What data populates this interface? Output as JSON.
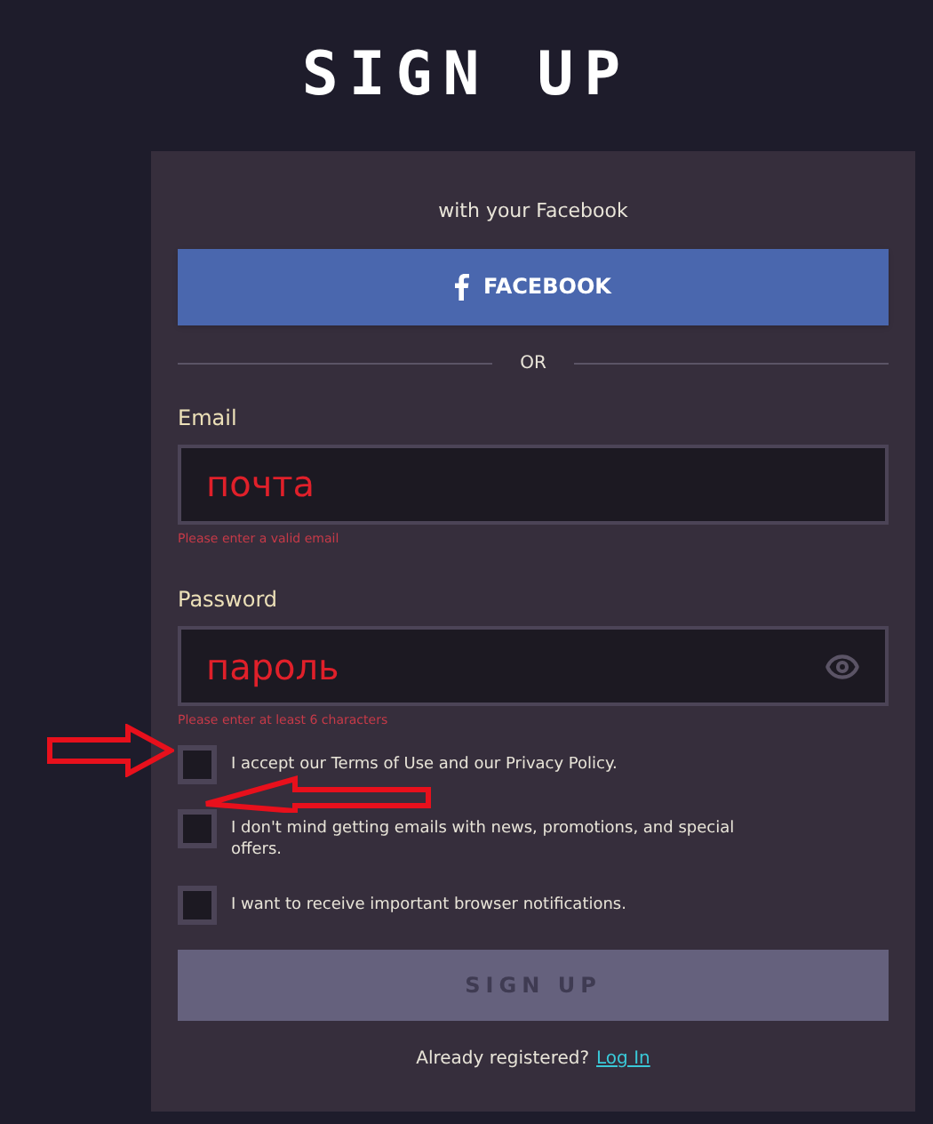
{
  "title": "SIGN UP",
  "facebook": {
    "caption": "with your Facebook",
    "button": "FACEBOOK"
  },
  "separator": "OR",
  "fields": [
    {
      "label": "Email",
      "value": "почта",
      "error": "Please enter a valid email",
      "kind": "text"
    },
    {
      "label": "Password",
      "value": "пароль",
      "error": "Please enter at least 6 characters",
      "kind": "password"
    }
  ],
  "checkboxes": [
    {
      "label": "I accept our Terms of Use and our Privacy Policy.",
      "checked": false
    },
    {
      "label": "I don't mind getting emails with news, promotions, and special offers.",
      "checked": false
    },
    {
      "label": "I want to receive important browser notifications.",
      "checked": false
    }
  ],
  "submit": {
    "label": "SIGN UP",
    "disabled": true
  },
  "footer": {
    "text": "Already registered?",
    "link": "Log In"
  }
}
